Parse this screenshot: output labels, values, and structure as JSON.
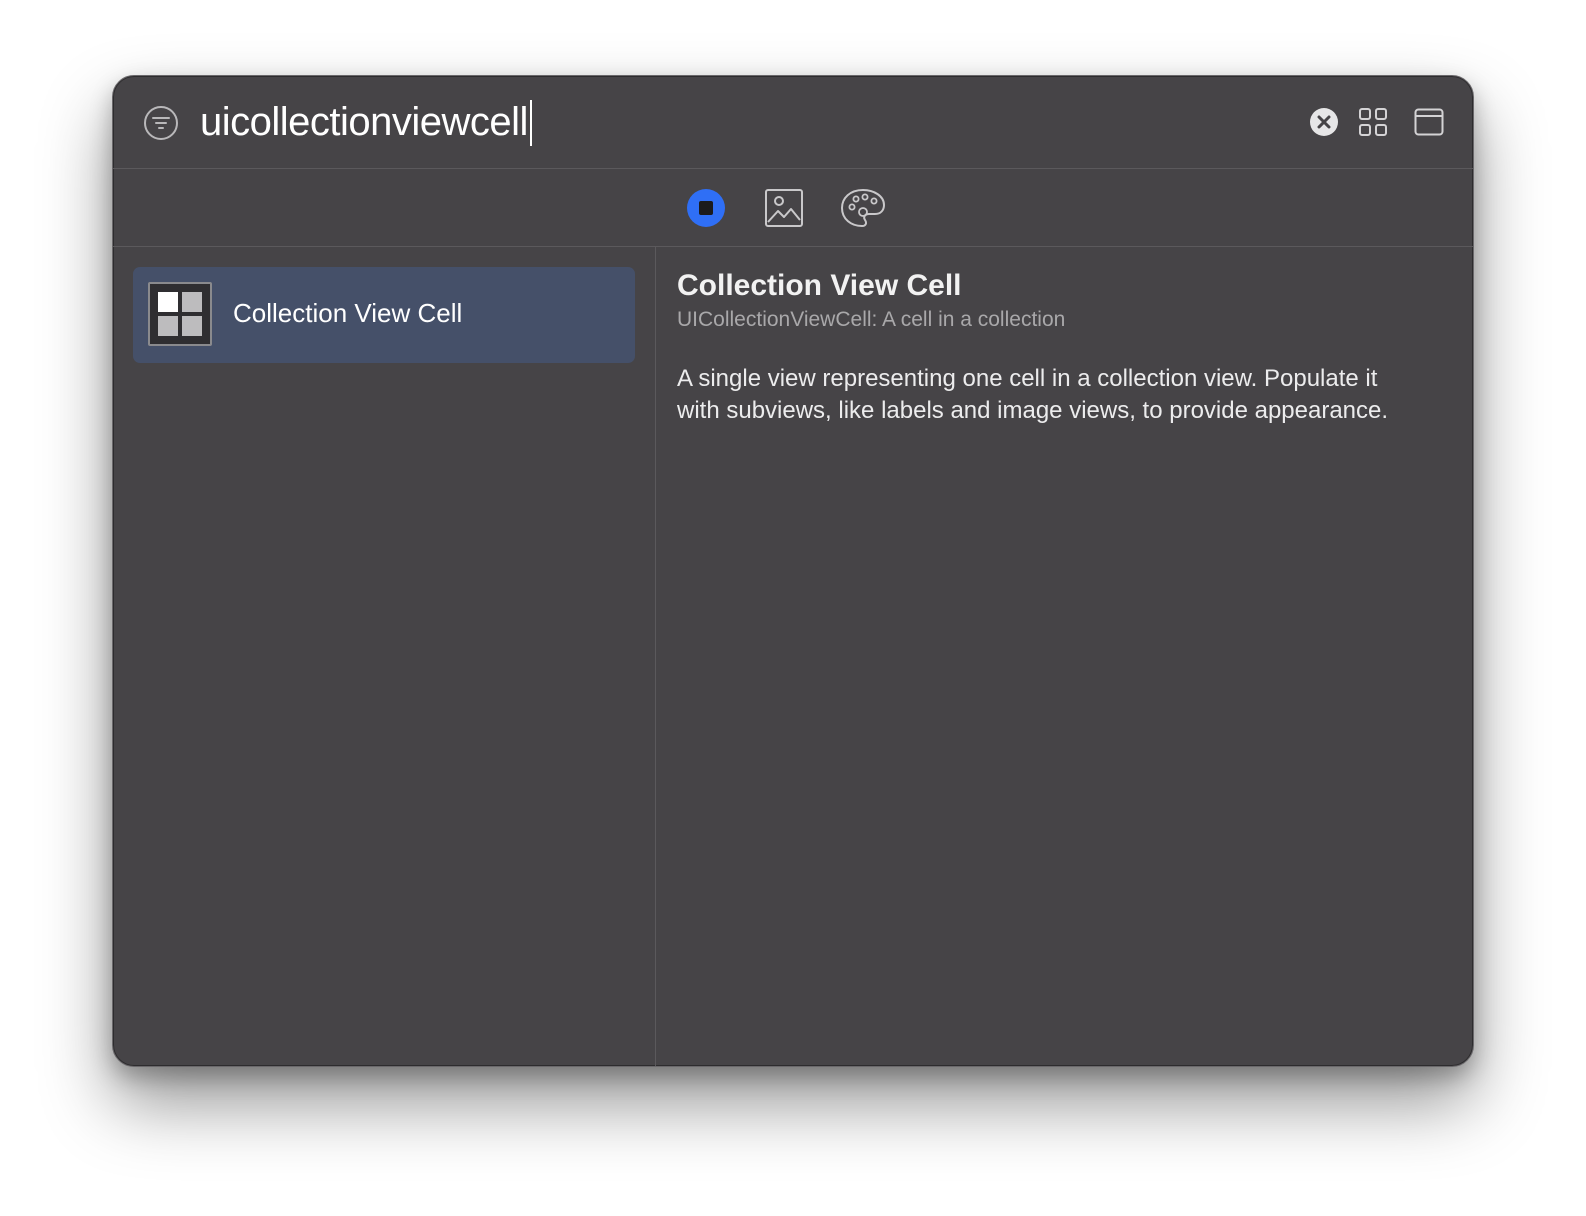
{
  "search": {
    "query": "uicollectionviewcell"
  },
  "toolbar": {
    "filter_icon": "filter-circle-icon",
    "clear_icon": "clear-x-circle-icon",
    "grid_icon": "grid-view-icon",
    "window_icon": "window-icon"
  },
  "tabs": [
    {
      "icon": "objects-icon",
      "selected": true
    },
    {
      "icon": "image-icon",
      "selected": false
    },
    {
      "icon": "palette-icon",
      "selected": false
    }
  ],
  "results": [
    {
      "label": "Collection View Cell",
      "icon": "collection-view-cell-icon",
      "selected": true
    }
  ],
  "detail": {
    "title": "Collection View Cell",
    "subtitle": "UICollectionViewCell: A cell in a collection",
    "description": "A single view representing one cell in a collection view. Populate it with subviews, like labels and image views, to provide appearance."
  },
  "colors": {
    "accent": "#2f6ff6",
    "selection": "#455069",
    "panel": "#464447"
  }
}
